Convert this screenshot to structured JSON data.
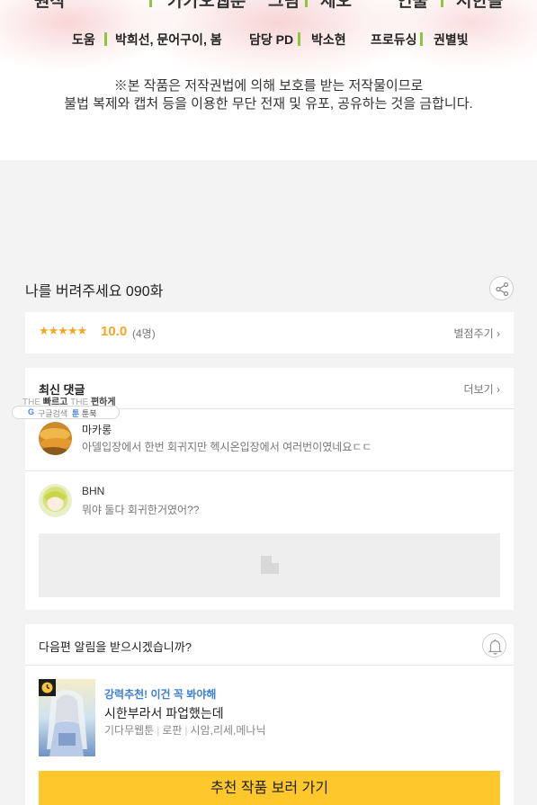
{
  "credits": {
    "top_row": [
      "원작",
      "카카오웹툰",
      "그림",
      "세오",
      "연출",
      "서한솔"
    ],
    "roles": [
      {
        "role": "도움",
        "names": "박희선, 문어구이, 봄"
      },
      {
        "role": "담당 PD",
        "names": "박소현"
      },
      {
        "role": "프로듀싱",
        "names": "권별빛"
      }
    ],
    "notice_line1": "※본 작품은 저작권법에 의해 보호를 받는 저작물이므로",
    "notice_line2": "불법 복제와 캡처 등을 이용한 무단 전재 및 유포, 공유하는 것을 금합니다."
  },
  "episode": {
    "title": "나를 버려주세요 090화",
    "share_icon": "share-icon"
  },
  "rating": {
    "stars": "★★★★★",
    "score": "10.0",
    "count": "(4명)",
    "rate_link": "별점주기 ›"
  },
  "comments": {
    "heading": "최신 댓글",
    "more_link": "더보기 ›",
    "items": [
      {
        "name": "마카롱",
        "text": "아델입장에서 한번 회귀지만 헥시온입장에서 여러번이였네요ㄷㄷ"
      },
      {
        "name": "BHN",
        "text": "뭐야 둘다 회귀한거였어??"
      }
    ]
  },
  "browser_overlay": {
    "line1_a": "THE",
    "line1_b": "빠르고",
    "line1_c": "THE",
    "line1_d": "편하게",
    "google_glyph": "G",
    "google_label": "구글검색",
    "toon_glyph": "툰",
    "toon_label": "툰북"
  },
  "notify": {
    "question": "다음편 알림을 받으시겠습니까?",
    "bell_icon": "bell-icon",
    "recommend_tag": "강력추천! 이건 꼭 봐야해",
    "recommend_title": "시한부라서 파업했는데",
    "meta": [
      "기다무웹툰",
      "로판",
      "시암,리세,메나닉"
    ],
    "cta_label": "추천 작품 보러 가기"
  },
  "colors": {
    "accent_bar": "#8cc63f",
    "star": "#f5a623",
    "link_blue": "#3c7fd4",
    "cta_yellow": "#fec72b"
  }
}
